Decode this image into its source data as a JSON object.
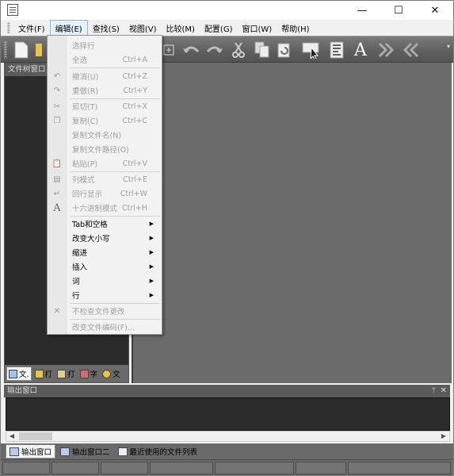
{
  "titlebar": {
    "minimize": "—",
    "maximize": "☐",
    "close": "✕"
  },
  "menubar": {
    "items": [
      {
        "label": "文件(F)"
      },
      {
        "label": "编辑(E)"
      },
      {
        "label": "查找(S)"
      },
      {
        "label": "视图(V)"
      },
      {
        "label": "比较(M)"
      },
      {
        "label": "配置(G)"
      },
      {
        "label": "窗口(W)"
      },
      {
        "label": "帮助(H)"
      }
    ]
  },
  "edit_menu": {
    "items": [
      {
        "label": "选择行",
        "shortcut": "",
        "enabled": false
      },
      {
        "label": "全选",
        "shortcut": "Ctrl+A",
        "enabled": false
      },
      {
        "label": "撤消(U)",
        "shortcut": "Ctrl+Z",
        "enabled": false
      },
      {
        "label": "重做(R)",
        "shortcut": "Ctrl+Y",
        "enabled": false
      },
      {
        "label": "剪切(T)",
        "shortcut": "Ctrl+X",
        "enabled": false
      },
      {
        "label": "复制(C)",
        "shortcut": "Ctrl+C",
        "enabled": false
      },
      {
        "label": "复制文件名(N)",
        "shortcut": "",
        "enabled": false
      },
      {
        "label": "复制文件路径(O)",
        "shortcut": "",
        "enabled": false
      },
      {
        "label": "粘贴(P)",
        "shortcut": "Ctrl+V",
        "enabled": false
      },
      {
        "label": "列模式",
        "shortcut": "Ctrl+E",
        "enabled": false
      },
      {
        "label": "回行显示",
        "shortcut": "Ctrl+W",
        "enabled": false
      },
      {
        "label": "十六进制模式",
        "shortcut": "Ctrl+H",
        "enabled": false
      },
      {
        "label": "Tab和空格",
        "enabled": true,
        "submenu": true
      },
      {
        "label": "改变大小写",
        "enabled": true,
        "submenu": true
      },
      {
        "label": "缩进",
        "enabled": true,
        "submenu": true
      },
      {
        "label": "插入",
        "enabled": true,
        "submenu": true
      },
      {
        "label": "词",
        "enabled": true,
        "submenu": true
      },
      {
        "label": "行",
        "enabled": true,
        "submenu": true
      },
      {
        "label": "不检查文件更改",
        "shortcut": "",
        "enabled": false
      },
      {
        "label": "改变文件编码(F)...",
        "shortcut": "",
        "enabled": false
      }
    ]
  },
  "left_panel": {
    "title": "文件树窗口",
    "tabs": [
      {
        "label": "文."
      },
      {
        "label": "打"
      },
      {
        "label": "打"
      },
      {
        "label": "字"
      },
      {
        "label": "文"
      }
    ]
  },
  "output_panel": {
    "title": "输出窗口",
    "pin": "ᛘ",
    "close": "✕"
  },
  "bottom_tabs": [
    {
      "label": "输出窗口"
    },
    {
      "label": "输出窗口二"
    },
    {
      "label": "最近使用的文件列表"
    }
  ],
  "colors": {
    "toolbar_bg": "#5e5e5e",
    "editor_bg": "#6b6b6b",
    "panel_bg": "#2b2b2b",
    "menu_active": "#e5f1fb"
  }
}
